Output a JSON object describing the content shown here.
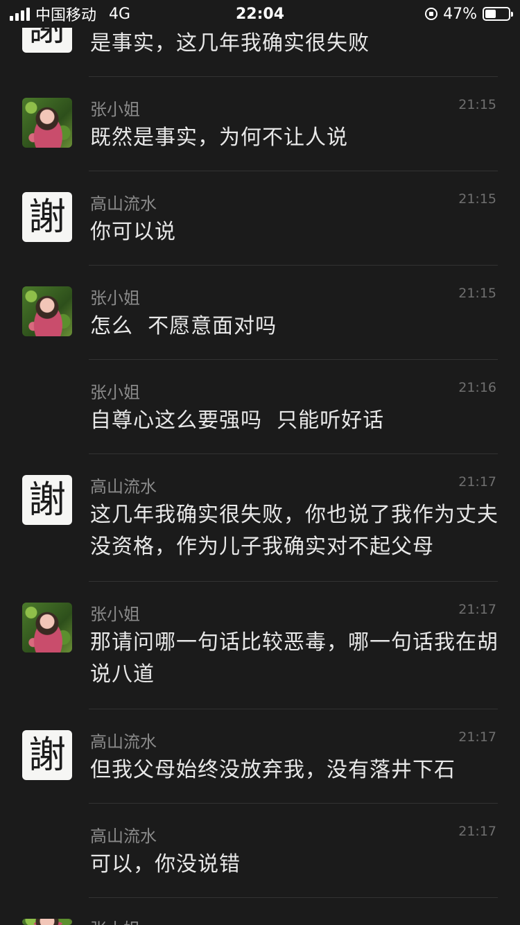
{
  "status_bar": {
    "carrier": "中国移动",
    "network": "4G",
    "time": "22:04",
    "battery": "47%",
    "battery_level": 0.47
  },
  "avatars": {
    "xie_char": "謝"
  },
  "messages": [
    {
      "sender": "",
      "time": "",
      "text": "是事实，这几年我确实很失败",
      "avatar": "xie"
    },
    {
      "sender": "张小姐",
      "time": "21:15",
      "text": "既然是事实，为何不让人说",
      "avatar": "photo"
    },
    {
      "sender": "高山流水",
      "time": "21:15",
      "text": "你可以说",
      "avatar": "xie"
    },
    {
      "sender": "张小姐",
      "time": "21:15",
      "text": "怎么  不愿意面对吗",
      "avatar": "photo"
    },
    {
      "sender": "张小姐",
      "time": "21:16",
      "text": "自尊心这么要强吗  只能听好话",
      "avatar": "none"
    },
    {
      "sender": "高山流水",
      "time": "21:17",
      "text": "这几年我确实很失败，你也说了我作为丈夫没资格，作为儿子我确实对不起父母",
      "avatar": "xie"
    },
    {
      "sender": "张小姐",
      "time": "21:17",
      "text": "那请问哪一句话比较恶毒，哪一句话我在胡说八道",
      "avatar": "photo"
    },
    {
      "sender": "高山流水",
      "time": "21:17",
      "text": "但我父母始终没放弃我，没有落井下石",
      "avatar": "xie"
    },
    {
      "sender": "高山流水",
      "time": "21:17",
      "text": "可以，你没说错",
      "avatar": "none"
    },
    {
      "sender": "张小姐",
      "time": "21:17",
      "text": "",
      "avatar": "photo"
    }
  ]
}
